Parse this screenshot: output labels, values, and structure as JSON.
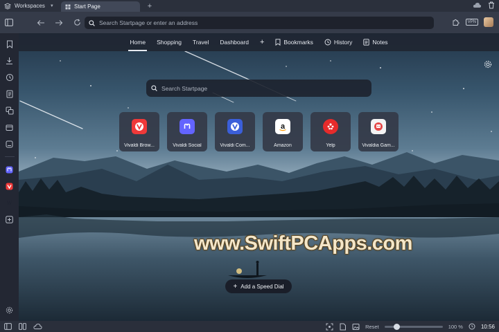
{
  "tabbar": {
    "workspaces_label": "Workspaces",
    "active_tab_title": "Start Page",
    "new_tab_glyph": "+"
  },
  "address": {
    "placeholder": "Search Startpage or enter an address",
    "vpn_label": "VPN"
  },
  "start_nav": {
    "items": [
      {
        "label": "Home",
        "icon": ""
      },
      {
        "label": "Shopping",
        "icon": ""
      },
      {
        "label": "Travel",
        "icon": ""
      },
      {
        "label": "Dashboard",
        "icon": ""
      },
      {
        "label": "+",
        "icon": ""
      },
      {
        "label": "Bookmarks",
        "icon": "bookmark-icon"
      },
      {
        "label": "History",
        "icon": "history-icon"
      },
      {
        "label": "Notes",
        "icon": "notes-icon"
      }
    ],
    "active_index": 0
  },
  "search": {
    "placeholder": "Search Startpage"
  },
  "speed_dials": [
    {
      "label": "Vivaldi Brow...",
      "icon": "vivaldi-icon",
      "color": "#ef3939"
    },
    {
      "label": "Vivaldi Social",
      "icon": "mastodon-icon",
      "color": "#6364ff"
    },
    {
      "label": "Vivaldi Com...",
      "icon": "vivaldi-community-icon",
      "color": "#3b5fd9"
    },
    {
      "label": "Amazon",
      "icon": "amazon-icon",
      "color": "#ffffff"
    },
    {
      "label": "Yelp",
      "icon": "yelp-icon",
      "color": "#e62b2b"
    },
    {
      "label": "Vivaldia Gam...",
      "icon": "vivaldia-game-icon",
      "color": "#e54848"
    }
  ],
  "watermark": "www.SwiftPCApps.com",
  "add_speed_dial": {
    "label": "Add a Speed Dial"
  },
  "statusbar": {
    "reset_label": "Reset",
    "zoom_level": "100 %",
    "zoom_fraction": 0.18,
    "clock": "10:56"
  },
  "colors": {
    "accent_red": "#ef3939",
    "mastodon": "#6364ff"
  }
}
